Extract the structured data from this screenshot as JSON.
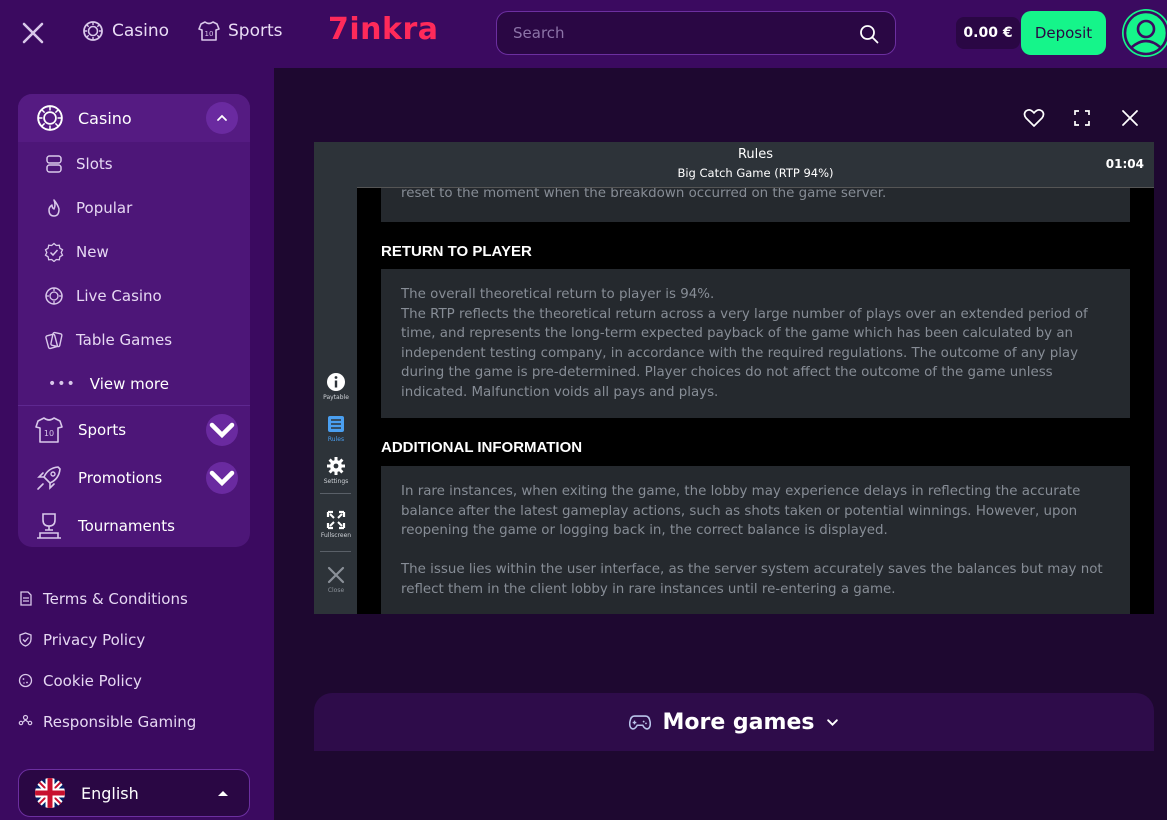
{
  "topbar": {
    "casino_label": "Casino",
    "sports_label": "Sports",
    "logo_text": "7inkra",
    "search_placeholder": "Search",
    "balance": "0.00 €",
    "deposit_label": "Deposit"
  },
  "sidebar": {
    "casino": {
      "label": "Casino",
      "items": [
        {
          "label": "Slots",
          "icon": "slots-icon"
        },
        {
          "label": "Popular",
          "icon": "flame-icon"
        },
        {
          "label": "New",
          "icon": "new-badge-icon"
        },
        {
          "label": "Live Casino",
          "icon": "chip-icon"
        },
        {
          "label": "Table Games",
          "icon": "cards-icon"
        }
      ],
      "view_more": "View more"
    },
    "sports_label": "Sports",
    "promotions_label": "Promotions",
    "tournaments_label": "Tournaments",
    "links": [
      {
        "label": "Terms & Conditions",
        "icon": "document-icon"
      },
      {
        "label": "Privacy Policy",
        "icon": "shield-icon"
      },
      {
        "label": "Cookie Policy",
        "icon": "cookie-icon"
      },
      {
        "label": "Responsible Gaming",
        "icon": "people-icon"
      }
    ],
    "language": "English"
  },
  "game": {
    "header_title": "Rules",
    "header_subtitle": "Big Catch Game (RTP 94%)",
    "time": "01:04",
    "tools": [
      {
        "label": "Paytable",
        "icon": "info-icon"
      },
      {
        "label": "Rules",
        "icon": "rules-icon"
      },
      {
        "label": "Settings",
        "icon": "settings-icon"
      },
      {
        "label": "Fullscreen",
        "icon": "fullscreen-icon"
      },
      {
        "label": "Close",
        "icon": "close-icon"
      }
    ],
    "partial_text": "reset to the moment when the breakdown occurred on the game server.",
    "rtp_heading": "RETURN TO PLAYER",
    "rtp_line1": "The overall theoretical return to player is 94%.",
    "rtp_line2": "The RTP reflects the theoretical return across a very large number of plays over an extended period of time, and represents the long-term expected payback of the game which has been calculated by an independent testing company, in accordance with the required regulations. The outcome of any play during the game is pre-determined. Player choices do not affect the outcome of the game unless indicated. Malfunction voids all pays and plays.",
    "info_heading": "ADDITIONAL INFORMATION",
    "info_para1": "In rare instances, when exiting the game, the lobby may experience delays in reflecting the accurate balance after the latest gameplay actions, such as shots taken or potential winnings. However, upon reopening the game or logging back in, the correct balance is displayed.",
    "info_para2": "The issue lies within the user interface, as the server system accurately saves the balances but may not reflect them in the client lobby in rare instances until re-entering a game."
  },
  "more_games_label": "More games",
  "colors": {
    "accent_green": "#15f58a",
    "brand_red": "#ff2a5a",
    "topbar_purple": "#3b0a60",
    "main_bg": "#1e0830"
  }
}
